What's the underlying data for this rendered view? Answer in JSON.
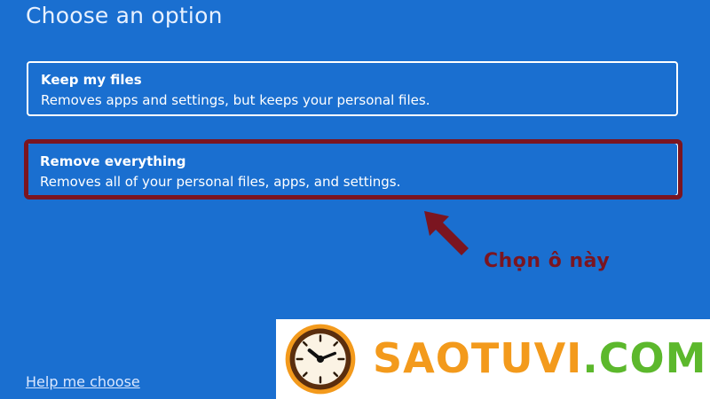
{
  "page": {
    "title": "Choose an option"
  },
  "options": [
    {
      "title": "Keep my files",
      "description": "Removes apps and settings, but keeps your personal files."
    },
    {
      "title": "Remove everything",
      "description": "Removes all of your personal files, apps, and settings."
    }
  ],
  "annotation": {
    "text": "Chọn ô này",
    "color": "#7b1520"
  },
  "help": {
    "label": "Help me choose"
  },
  "watermark": {
    "text_part1": "SAOTUVI",
    "text_part2": ".COM",
    "logo_icon": "clock-icon",
    "color_part1": "#f39a1c",
    "color_part2": "#5cb82c"
  },
  "colors": {
    "background": "#1a6fd0",
    "highlight": "#7b1520"
  }
}
